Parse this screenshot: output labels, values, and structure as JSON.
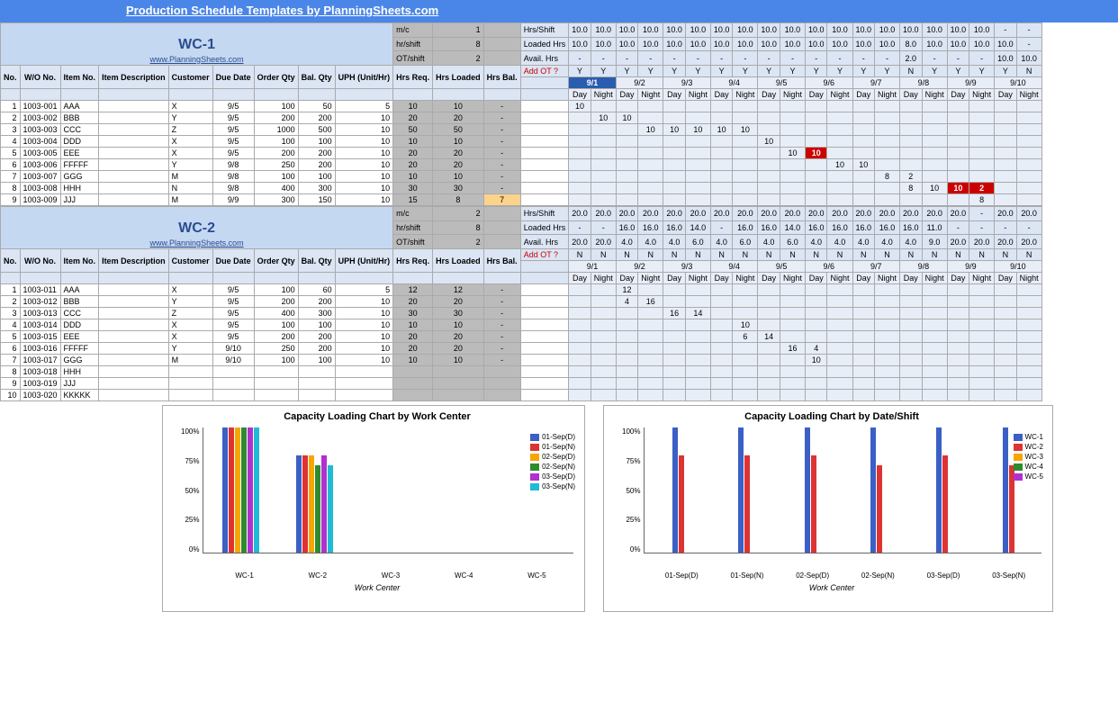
{
  "title": "Production Schedule Templates by PlanningSheets.com",
  "link_text": "www.PlanningSheets.com",
  "wc_labels": [
    "WC-1",
    "WC-2"
  ],
  "cap_labels": {
    "mc": "m/c",
    "hrsh": "hr/shift",
    "otsh": "OT/shift",
    "hrs_shift": "Hrs/Shift",
    "loaded": "Loaded Hrs",
    "avail": "Avail. Hrs",
    "addot": "Add OT ?"
  },
  "col_headers": [
    "No.",
    "W/O No.",
    "Item No.",
    "Item Description",
    "Customer",
    "Due Date",
    "Order Qty",
    "Bal. Qty",
    "UPH (Unit/Hr)",
    "Hrs Req.",
    "Hrs Loaded",
    "Hrs Bal."
  ],
  "dates": [
    "9/1",
    "9/2",
    "9/3",
    "9/4",
    "9/5",
    "9/6",
    "9/7",
    "9/8",
    "9/9",
    "9/10"
  ],
  "dn": [
    "Day",
    "Night"
  ],
  "wc1": {
    "mc": 1,
    "hrsh": 8,
    "otsh": 2,
    "hrs_shift": [
      "10.0",
      "10.0",
      "10.0",
      "10.0",
      "10.0",
      "10.0",
      "10.0",
      "10.0",
      "10.0",
      "10.0",
      "10.0",
      "10.0",
      "10.0",
      "10.0",
      "10.0",
      "10.0",
      "10.0",
      "10.0",
      "-",
      "-"
    ],
    "loaded_hrs": [
      "10.0",
      "10.0",
      "10.0",
      "10.0",
      "10.0",
      "10.0",
      "10.0",
      "10.0",
      "10.0",
      "10.0",
      "10.0",
      "10.0",
      "10.0",
      "10.0",
      "8.0",
      "10.0",
      "10.0",
      "10.0",
      "10.0",
      "-"
    ],
    "avail_hrs": [
      "-",
      "-",
      "-",
      "-",
      "-",
      "-",
      "-",
      "-",
      "-",
      "-",
      "-",
      "-",
      "-",
      "-",
      "2.0",
      "-",
      "-",
      "-",
      "10.0",
      "10.0"
    ],
    "addot": [
      "Y",
      "Y",
      "Y",
      "Y",
      "Y",
      "Y",
      "Y",
      "Y",
      "Y",
      "Y",
      "Y",
      "Y",
      "Y",
      "Y",
      "N",
      "Y",
      "Y",
      "Y",
      "Y",
      "N"
    ],
    "rows": [
      {
        "no": 1,
        "wo": "1003-001",
        "item": "AAA",
        "cust": "X",
        "due": "9/5",
        "oq": 100,
        "bq": 50,
        "uph": 5,
        "req": 10,
        "ld": 10,
        "bal": "-",
        "sched": [
          [
            0,
            10
          ]
        ]
      },
      {
        "no": 2,
        "wo": "1003-002",
        "item": "BBB",
        "cust": "Y",
        "due": "9/5",
        "oq": 200,
        "bq": 200,
        "uph": 10,
        "req": 20,
        "ld": 20,
        "bal": "-",
        "sched": [
          [
            1,
            10
          ],
          [
            2,
            10
          ]
        ]
      },
      {
        "no": 3,
        "wo": "1003-003",
        "item": "CCC",
        "cust": "Z",
        "due": "9/5",
        "oq": 1000,
        "bq": 500,
        "uph": 10,
        "req": 50,
        "ld": 50,
        "bal": "-",
        "sched": [
          [
            3,
            10
          ],
          [
            4,
            10
          ],
          [
            5,
            10
          ],
          [
            6,
            10
          ],
          [
            7,
            10
          ]
        ]
      },
      {
        "no": 4,
        "wo": "1003-004",
        "item": "DDD",
        "cust": "X",
        "due": "9/5",
        "oq": 100,
        "bq": 100,
        "uph": 10,
        "req": 10,
        "ld": 10,
        "bal": "-",
        "sched": [
          [
            8,
            10
          ]
        ]
      },
      {
        "no": 5,
        "wo": "1003-005",
        "item": "EEE",
        "cust": "X",
        "due": "9/5",
        "oq": 200,
        "bq": 200,
        "uph": 10,
        "req": 20,
        "ld": 20,
        "bal": "-",
        "sched": [
          [
            9,
            10
          ],
          [
            10,
            "10",
            "red"
          ]
        ]
      },
      {
        "no": 6,
        "wo": "1003-006",
        "item": "FFFFF",
        "cust": "Y",
        "due": "9/8",
        "oq": 250,
        "bq": 200,
        "uph": 10,
        "req": 20,
        "ld": 20,
        "bal": "-",
        "sched": [
          [
            11,
            10
          ],
          [
            12,
            10
          ]
        ]
      },
      {
        "no": 7,
        "wo": "1003-007",
        "item": "GGG",
        "cust": "M",
        "due": "9/8",
        "oq": 100,
        "bq": 100,
        "uph": 10,
        "req": 10,
        "ld": 10,
        "bal": "-",
        "sched": [
          [
            13,
            8
          ],
          [
            14,
            2
          ]
        ]
      },
      {
        "no": 8,
        "wo": "1003-008",
        "item": "HHH",
        "cust": "N",
        "due": "9/8",
        "oq": 400,
        "bq": 300,
        "uph": 10,
        "req": 30,
        "ld": 30,
        "bal": "-",
        "sched": [
          [
            14,
            8
          ],
          [
            15,
            10
          ],
          [
            16,
            "10",
            "red"
          ],
          [
            17,
            "2",
            "red"
          ]
        ]
      },
      {
        "no": 9,
        "wo": "1003-009",
        "item": "JJJ",
        "cust": "M",
        "due": "9/9",
        "oq": 300,
        "bq": 150,
        "uph": 10,
        "req": 15,
        "ld": 8,
        "bal": 7,
        "balcls": "orange",
        "sched": [
          [
            17,
            8
          ]
        ]
      }
    ]
  },
  "wc2": {
    "mc": 2,
    "hrsh": 8,
    "otsh": 2,
    "hrs_shift": [
      "20.0",
      "20.0",
      "20.0",
      "20.0",
      "20.0",
      "20.0",
      "20.0",
      "20.0",
      "20.0",
      "20.0",
      "20.0",
      "20.0",
      "20.0",
      "20.0",
      "20.0",
      "20.0",
      "20.0",
      "-",
      "20.0",
      "20.0"
    ],
    "loaded_hrs": [
      "-",
      "-",
      "16.0",
      "16.0",
      "16.0",
      "14.0",
      "-",
      "16.0",
      "16.0",
      "14.0",
      "16.0",
      "16.0",
      "16.0",
      "16.0",
      "16.0",
      "11.0",
      "-",
      "-",
      "-",
      "-"
    ],
    "avail_hrs": [
      "20.0",
      "20.0",
      "4.0",
      "4.0",
      "4.0",
      "6.0",
      "4.0",
      "6.0",
      "4.0",
      "6.0",
      "4.0",
      "4.0",
      "4.0",
      "4.0",
      "4.0",
      "9.0",
      "20.0",
      "20.0",
      "20.0",
      "20.0"
    ],
    "addot": [
      "N",
      "N",
      "N",
      "N",
      "N",
      "N",
      "N",
      "N",
      "N",
      "N",
      "N",
      "N",
      "N",
      "N",
      "N",
      "N",
      "N",
      "N",
      "N",
      "N"
    ],
    "rows": [
      {
        "no": 1,
        "wo": "1003-011",
        "item": "AAA",
        "cust": "X",
        "due": "9/5",
        "oq": 100,
        "bq": 60,
        "uph": 5,
        "req": 12,
        "ld": 12,
        "bal": "-",
        "sched": [
          [
            2,
            12
          ]
        ]
      },
      {
        "no": 2,
        "wo": "1003-012",
        "item": "BBB",
        "cust": "Y",
        "due": "9/5",
        "oq": 200,
        "bq": 200,
        "uph": 10,
        "req": 20,
        "ld": 20,
        "bal": "-",
        "sched": [
          [
            2,
            4
          ],
          [
            3,
            16
          ]
        ]
      },
      {
        "no": 3,
        "wo": "1003-013",
        "item": "CCC",
        "cust": "Z",
        "due": "9/5",
        "oq": 400,
        "bq": 300,
        "uph": 10,
        "req": 30,
        "ld": 30,
        "bal": "-",
        "sched": [
          [
            4,
            16
          ],
          [
            5,
            14
          ]
        ]
      },
      {
        "no": 4,
        "wo": "1003-014",
        "item": "DDD",
        "cust": "X",
        "due": "9/5",
        "oq": 100,
        "bq": 100,
        "uph": 10,
        "req": 10,
        "ld": 10,
        "bal": "-",
        "sched": [
          [
            7,
            10
          ]
        ]
      },
      {
        "no": 5,
        "wo": "1003-015",
        "item": "EEE",
        "cust": "X",
        "due": "9/5",
        "oq": 200,
        "bq": 200,
        "uph": 10,
        "req": 20,
        "ld": 20,
        "bal": "-",
        "sched": [
          [
            7,
            6
          ],
          [
            8,
            14
          ]
        ]
      },
      {
        "no": 6,
        "wo": "1003-016",
        "item": "FFFFF",
        "cust": "Y",
        "due": "9/10",
        "oq": 250,
        "bq": 200,
        "uph": 10,
        "req": 20,
        "ld": 20,
        "bal": "-",
        "sched": [
          [
            9,
            16
          ],
          [
            10,
            4
          ]
        ]
      },
      {
        "no": 7,
        "wo": "1003-017",
        "item": "GGG",
        "cust": "M",
        "due": "9/10",
        "oq": 100,
        "bq": 100,
        "uph": 10,
        "req": 10,
        "ld": 10,
        "bal": "-",
        "sched": [
          [
            10,
            10
          ]
        ]
      },
      {
        "no": 8,
        "wo": "1003-018",
        "item": "HHH"
      },
      {
        "no": 9,
        "wo": "1003-019",
        "item": "JJJ"
      },
      {
        "no": 10,
        "wo": "1003-020",
        "item": "KKKKK"
      }
    ]
  },
  "chart_data": [
    {
      "type": "bar",
      "title": "Capacity Loading Chart by Work Center",
      "xlabel": "Work Center",
      "ylabel": "",
      "categories": [
        "WC-1",
        "WC-2",
        "WC-3",
        "WC-4",
        "WC-5"
      ],
      "y_ticks": [
        "100%",
        "75%",
        "50%",
        "25%",
        "0%"
      ],
      "series": [
        {
          "name": "01-Sep(D)",
          "color": "#3b5fc4",
          "values": [
            100,
            78,
            0,
            0,
            0
          ]
        },
        {
          "name": "01-Sep(N)",
          "color": "#d33",
          "values": [
            100,
            78,
            0,
            0,
            0
          ]
        },
        {
          "name": "02-Sep(D)",
          "color": "#f7a500",
          "values": [
            100,
            78,
            0,
            0,
            0
          ]
        },
        {
          "name": "02-Sep(N)",
          "color": "#2e8b2e",
          "values": [
            100,
            70,
            0,
            0,
            0
          ]
        },
        {
          "name": "03-Sep(D)",
          "color": "#b030d0",
          "values": [
            100,
            78,
            0,
            0,
            0
          ]
        },
        {
          "name": "03-Sep(N)",
          "color": "#1fbad6",
          "values": [
            100,
            70,
            0,
            0,
            0
          ]
        }
      ]
    },
    {
      "type": "bar",
      "title": "Capacity Loading Chart by Date/Shift",
      "xlabel": "Work Center",
      "ylabel": "",
      "categories": [
        "01-Sep(D)",
        "01-Sep(N)",
        "02-Sep(D)",
        "02-Sep(N)",
        "03-Sep(D)",
        "03-Sep(N)"
      ],
      "y_ticks": [
        "100%",
        "75%",
        "50%",
        "25%",
        "0%"
      ],
      "series": [
        {
          "name": "WC-1",
          "color": "#3b5fc4",
          "values": [
            100,
            100,
            100,
            100,
            100,
            100
          ]
        },
        {
          "name": "WC-2",
          "color": "#d33",
          "values": [
            78,
            78,
            78,
            70,
            78,
            70
          ]
        },
        {
          "name": "WC-3",
          "color": "#f7a500",
          "values": [
            0,
            0,
            0,
            0,
            0,
            0
          ]
        },
        {
          "name": "WC-4",
          "color": "#2e8b2e",
          "values": [
            0,
            0,
            0,
            0,
            0,
            0
          ]
        },
        {
          "name": "WC-5",
          "color": "#b030d0",
          "values": [
            0,
            0,
            0,
            0,
            0,
            0
          ]
        }
      ]
    }
  ]
}
